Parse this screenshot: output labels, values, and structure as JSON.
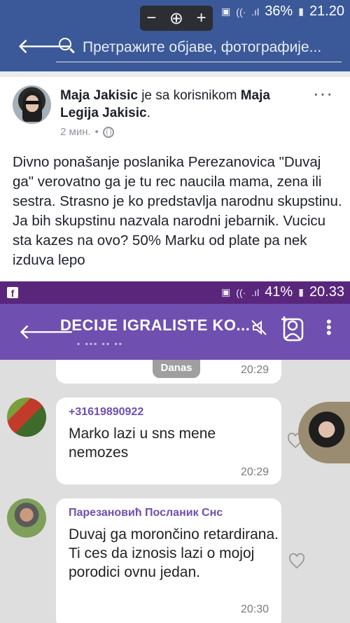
{
  "status_top": {
    "battery": "36%",
    "time": "21.20"
  },
  "zoom": {
    "minus": "−",
    "plus": "+"
  },
  "search": {
    "placeholder": "Претражите објаве, фотографије..."
  },
  "post": {
    "author": "Maja Jakisic",
    "connector": "je sa korisnikom",
    "tagged": "Maja Legija Jakisic",
    "time": "2 мин.",
    "separator": "•",
    "text": "Divno ponašanje poslanika Perezanovica \"Duvaj ga\" verovatno ga je tu rec naucila mama, zena ili sestra. Strasno je ko predstavlja narodnu skupstinu. Ja bih skupstinu nazvala narodni jebarnik. Vucicu sta kazes na ovo? 50% Marku od plate pa nek izduva lepo"
  },
  "status_viber": {
    "battery": "41%",
    "time": "20.33"
  },
  "viber": {
    "title": "DECIJE IGRALISTE KO...",
    "date_badge": "Danas",
    "messages": [
      {
        "time": "20:29"
      },
      {
        "sender": "+31619890922",
        "text": "Marko lazi u sns mene nemozes",
        "time": "20:29"
      },
      {
        "sender": "Парезановић Посланик Снс",
        "text": "Duvaj ga morončino retardirana. Ti ces da iznosis lazi o mojoj porodici ovnu jedan.",
        "time": "20:30"
      }
    ]
  },
  "colors": {
    "facebook_blue": "#3b5998",
    "viber_purple": "#6f4fb0"
  }
}
